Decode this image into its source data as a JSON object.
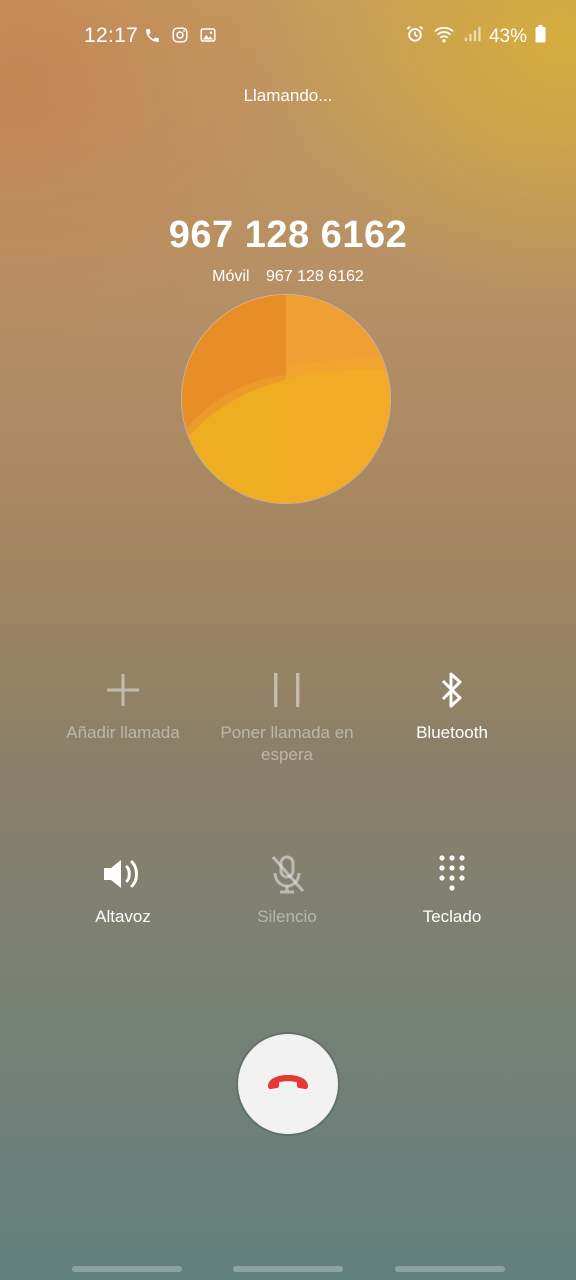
{
  "status_bar": {
    "time": "12:17",
    "left_icons": [
      "phone-icon",
      "instagram-icon",
      "gallery-icon"
    ],
    "right_icons": [
      "alarm-icon",
      "wifi-icon",
      "signal-icon",
      "battery-icon"
    ],
    "battery": "43%"
  },
  "call": {
    "status": "Llamando...",
    "number": "967 128 6162",
    "type_label": "Móvil",
    "sub_number": "967 128 6162"
  },
  "controls": {
    "add_call": "Añadir llamada",
    "hold": "Poner llamada en espera",
    "bluetooth": "Bluetooth",
    "speaker": "Altavoz",
    "mute": "Silencio",
    "keypad": "Teclado"
  },
  "colors": {
    "end_call_icon": "#e53935",
    "avatar_orange": "#f0a030"
  }
}
